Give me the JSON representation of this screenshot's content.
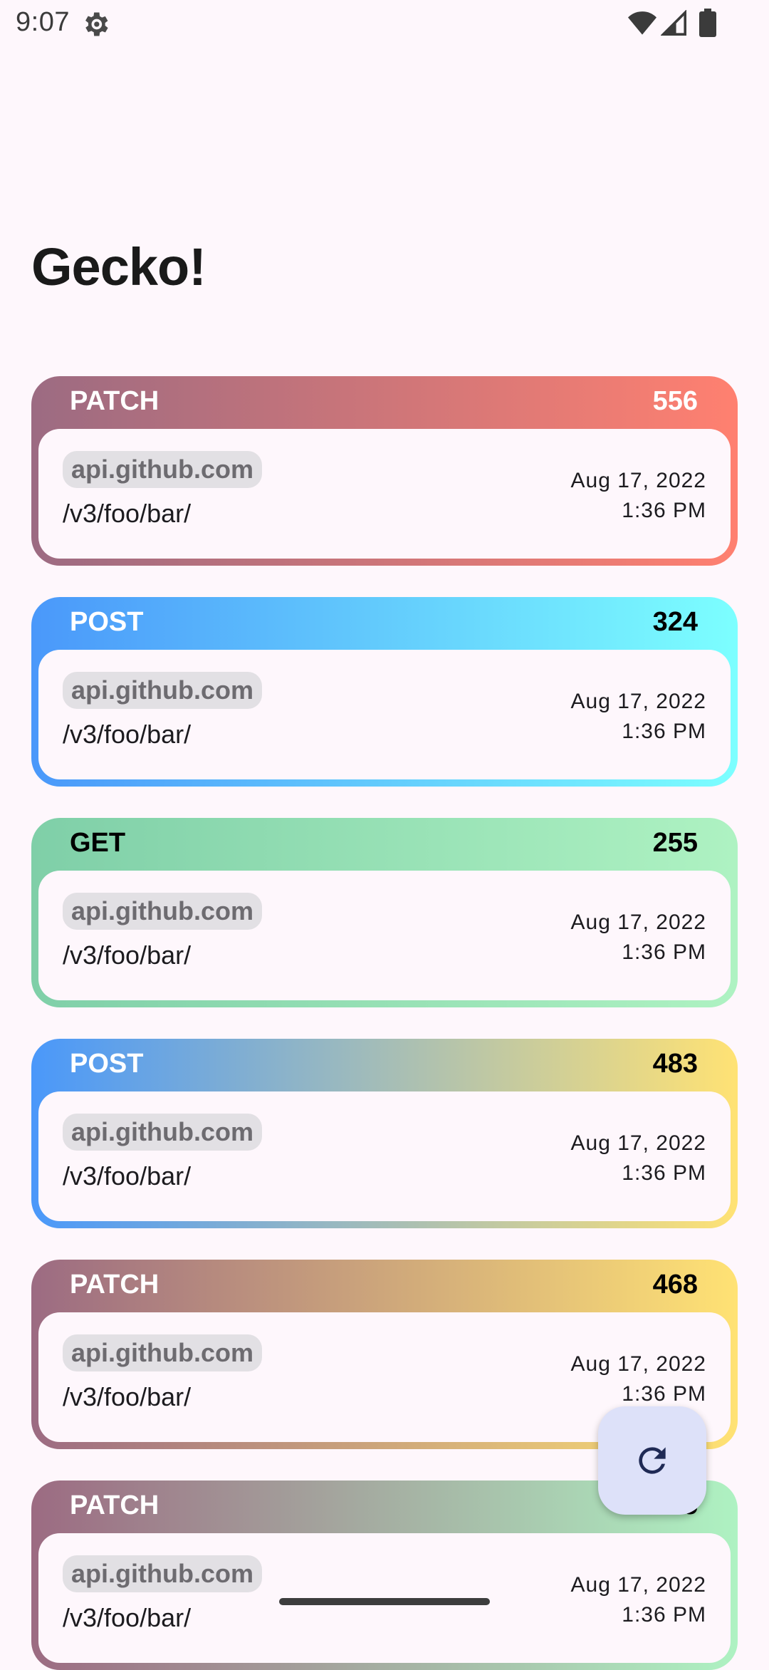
{
  "status_bar": {
    "time": "9:07"
  },
  "app": {
    "title": "Gecko!"
  },
  "requests": [
    {
      "method": "PATCH",
      "count": "556",
      "host": "api.github.com",
      "path": "/v3/foo/bar/",
      "date": "Aug 17, 2022",
      "time": "1:36 PM",
      "colors": [
        "#9c6b82",
        "#ff8070"
      ],
      "header_text_color": "#ffffff",
      "count_text_color": "#ffffff"
    },
    {
      "method": "POST",
      "count": "324",
      "host": "api.github.com",
      "path": "/v3/foo/bar/",
      "date": "Aug 17, 2022",
      "time": "1:36 PM",
      "colors": [
        "#4a98fa",
        "#7cffff"
      ],
      "header_text_color": "#ffffff",
      "count_text_color": "#000000"
    },
    {
      "method": "GET",
      "count": "255",
      "host": "api.github.com",
      "path": "/v3/foo/bar/",
      "date": "Aug 17, 2022",
      "time": "1:36 PM",
      "colors": [
        "#7fcfa8",
        "#aef2c2"
      ],
      "header_text_color": "#000000",
      "count_text_color": "#000000"
    },
    {
      "method": "POST",
      "count": "483",
      "host": "api.github.com",
      "path": "/v3/foo/bar/",
      "date": "Aug 17, 2022",
      "time": "1:36 PM",
      "colors": [
        "#4a98fa",
        "#ffe274"
      ],
      "header_text_color": "#ffffff",
      "count_text_color": "#000000"
    },
    {
      "method": "PATCH",
      "count": "468",
      "host": "api.github.com",
      "path": "/v3/foo/bar/",
      "date": "Aug 17, 2022",
      "time": "1:36 PM",
      "colors": [
        "#9c6b82",
        "#ffe274"
      ],
      "header_text_color": "#ffffff",
      "count_text_color": "#000000"
    },
    {
      "method": "PATCH",
      "count": "255",
      "host": "api.github.com",
      "path": "/v3/foo/bar/",
      "date": "Aug 17, 2022",
      "time": "1:36 PM",
      "colors": [
        "#9c6b82",
        "#aef2c2"
      ],
      "header_text_color": "#ffffff",
      "count_text_color": "#000000"
    }
  ],
  "icons": {
    "settings": "gear-icon",
    "wifi": "wifi-icon",
    "signal": "signal-icon",
    "battery": "battery-icon",
    "refresh": "refresh-icon"
  },
  "fab": {
    "background": "#dde1f9",
    "icon_color": "#1f2a55"
  }
}
